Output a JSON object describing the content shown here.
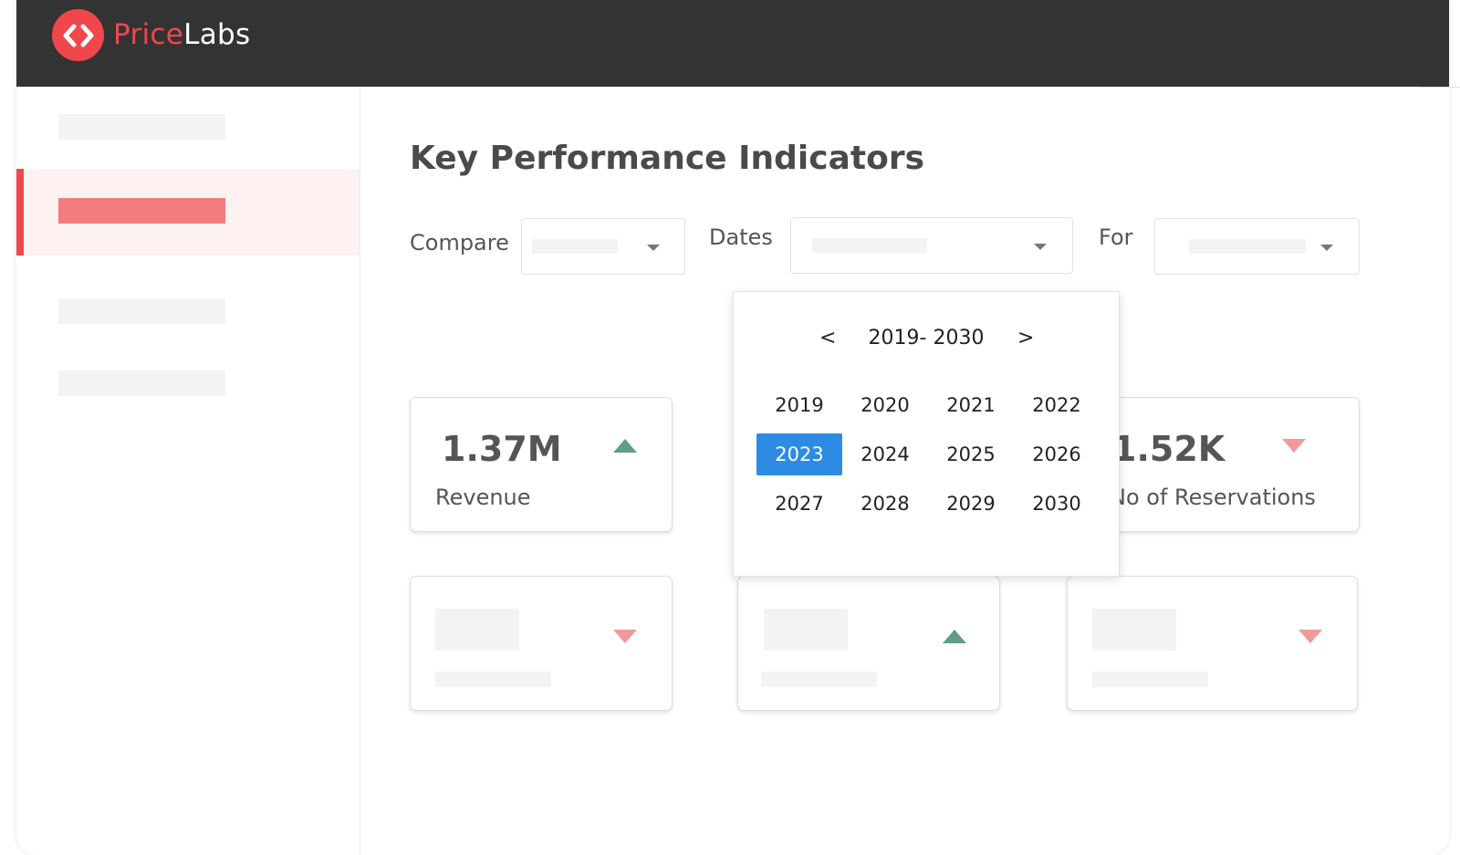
{
  "brand": {
    "name_part1": "Price",
    "name_part2": "Labs",
    "accent_color": "#f0474c"
  },
  "main": {
    "title": "Key Performance Indicators",
    "filters": {
      "compare_label": "Compare",
      "dates_label": "Dates",
      "for_label": "For"
    }
  },
  "kpis": [
    {
      "value": "1.37M",
      "label": "Revenue",
      "trend": "up"
    },
    {
      "value": "1.52K",
      "label": "No of Reservations",
      "trend": "down"
    }
  ],
  "year_picker": {
    "prev": "<",
    "next": ">",
    "range": "2019- 2030",
    "years": [
      "2019",
      "2020",
      "2021",
      "2022",
      "2023",
      "2024",
      "2025",
      "2026",
      "2027",
      "2028",
      "2029",
      "2030"
    ],
    "selected": "2023",
    "selected_color": "#2d8be3"
  },
  "colors": {
    "trend_up": "#5f9e83",
    "trend_down": "#f1999b",
    "topbar": "#333333"
  }
}
